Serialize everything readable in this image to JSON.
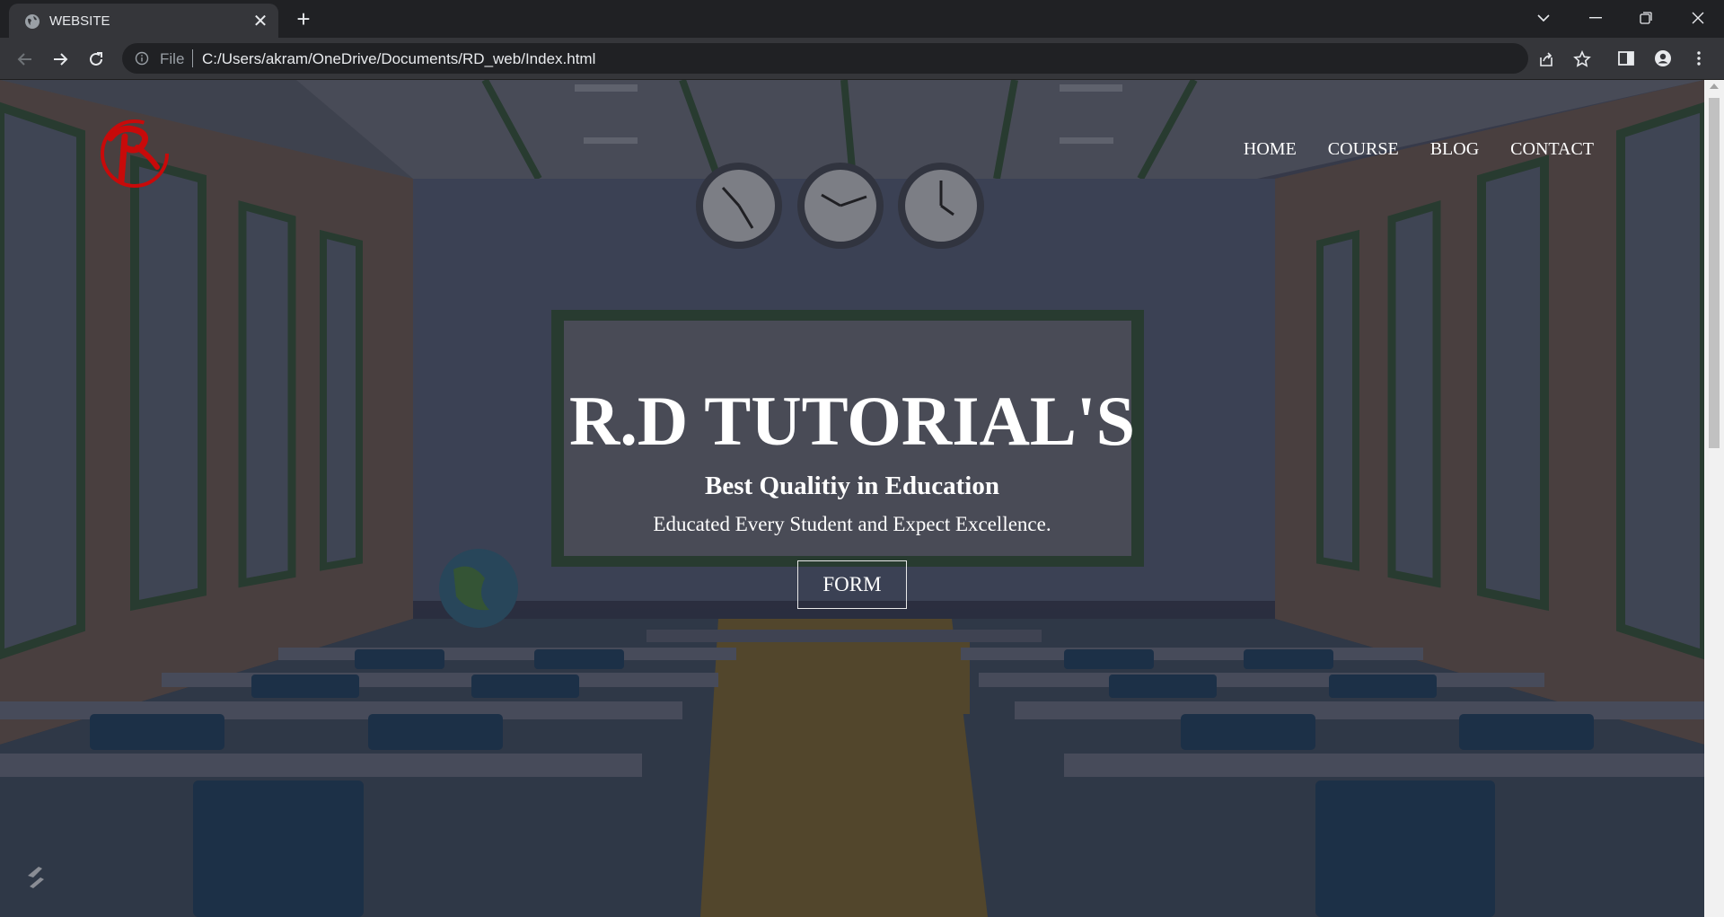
{
  "browser": {
    "tab": {
      "title": "WEBSITE",
      "close_label": "✕"
    },
    "new_tab_label": "+",
    "omnibox": {
      "scheme_label": "File",
      "url": "C:/Users/akram/OneDrive/Documents/RD_web/Index.html"
    },
    "icons": [
      "globe-icon",
      "back-icon",
      "forward-icon",
      "reload-icon",
      "info-icon",
      "share-icon",
      "star-icon",
      "side-panel-icon",
      "profile-icon",
      "menu-icon",
      "tab-search-icon",
      "minimize-icon",
      "restore-icon",
      "close-icon"
    ]
  },
  "page": {
    "nav": {
      "items": [
        {
          "label": "HOME"
        },
        {
          "label": "COURSE"
        },
        {
          "label": "BLOG"
        },
        {
          "label": "CONTACT"
        }
      ]
    },
    "hero": {
      "title": "R.D TUTORIAL'S",
      "subtitle": "Best Qualitiy in Education",
      "tagline": "Educated Every Student and Expect Excellence.",
      "button_label": "FORM"
    },
    "colors": {
      "logo_red": "#c80a0a",
      "chrome_dark": "#202124",
      "chrome_toolbar": "#35363a",
      "text_light": "#e8eaed"
    }
  }
}
